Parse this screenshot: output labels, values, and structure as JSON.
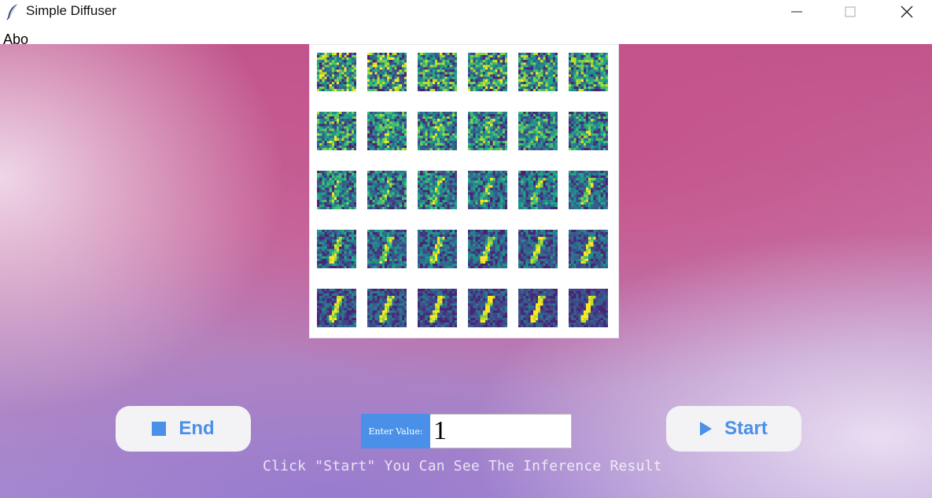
{
  "window": {
    "title": "Simple Diffuser",
    "icon": "feather-icon",
    "controls": [
      "minimize-icon",
      "maximize-icon",
      "close-icon"
    ]
  },
  "menu": {
    "items": [
      "Abo"
    ]
  },
  "grid": {
    "rows": 5,
    "cols": 6,
    "colormap": "viridis",
    "description_colors": [
      "#440154",
      "#31688e",
      "#21918c",
      "#35b779",
      "#fde725"
    ]
  },
  "controls": {
    "end_label": "End",
    "start_label": "Start",
    "end_icon": "stop-icon",
    "start_icon": "play-icon",
    "accent_color": "#4a90e8"
  },
  "input": {
    "label": "Enter Value:",
    "value": "1"
  },
  "hint": "Click \"Start\" You Can See The Inference Result"
}
